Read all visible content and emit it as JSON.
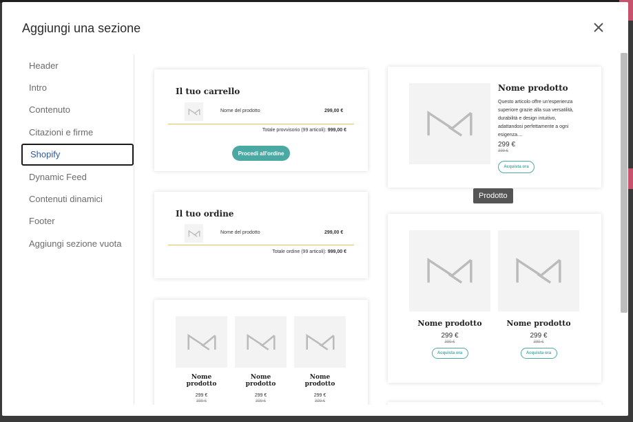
{
  "modal": {
    "title": "Aggiungi una sezione"
  },
  "sidebar": {
    "items": [
      {
        "label": "Header"
      },
      {
        "label": "Intro"
      },
      {
        "label": "Contenuto"
      },
      {
        "label": "Citazioni e firme"
      },
      {
        "label": "Shopify"
      },
      {
        "label": "Dynamic Feed"
      },
      {
        "label": "Contenuti dinamici"
      },
      {
        "label": "Footer"
      },
      {
        "label": "Aggiungi sezione vuota"
      }
    ],
    "active": "Shopify"
  },
  "cards": {
    "cart": {
      "title": "Il tuo carrello",
      "product_name": "Nome del prodotto",
      "price": "299,00 €",
      "subtotal_label": "Totale provvisorio (99 articoli):",
      "subtotal_value": "999,00 €",
      "button": "Procedi all'ordine"
    },
    "order": {
      "title": "Il tuo ordine",
      "product_name": "Nome del prodotto",
      "price": "299,00 €",
      "total_label": "Totale ordine (99 articoli):",
      "total_value": "999,00 €"
    },
    "product": {
      "name": "Nome prodotto",
      "description": "Questo articolo offre un'esperienza superiore grazie alla sua versatilità, durabilità e design intuitivo, adattandosi perfettamente a ogni esigenza....",
      "price": "299 €",
      "old_price": "399 €",
      "button": "Acquista ora"
    },
    "two_products": [
      {
        "name": "Nome prodotto",
        "price": "299 €",
        "old_price": "399 €",
        "button": "Acquista ora"
      },
      {
        "name": "Nome prodotto",
        "price": "299 €",
        "old_price": "399 €",
        "button": "Acquista ora"
      }
    ],
    "three_products": [
      {
        "name": "Nome prodotto",
        "price": "299 €",
        "old_price": "399 €"
      },
      {
        "name": "Nome prodotto",
        "price": "299 €",
        "old_price": "399 €"
      },
      {
        "name": "Nome prodotto",
        "price": "299 €",
        "old_price": "399 €"
      }
    ]
  },
  "tooltip": {
    "text": "Prodotto"
  },
  "colors": {
    "accent": "#4aa9a2",
    "active_text": "#2d5aa0",
    "divider_gold": "#e3c25a"
  },
  "icons": {
    "close": "close-icon",
    "placeholder": "image-placeholder-icon"
  }
}
